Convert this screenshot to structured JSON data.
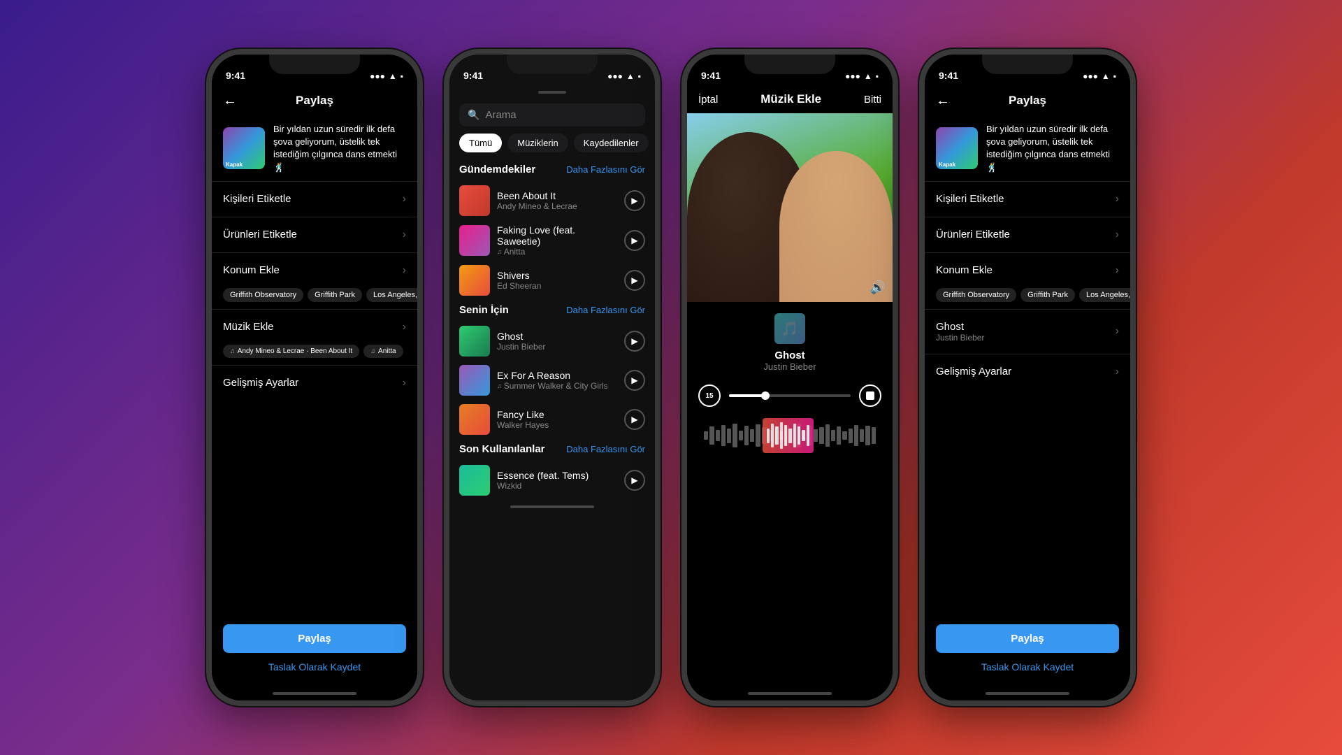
{
  "background": {
    "gradient": "linear-gradient(135deg, #3a1c8c 0%, #7b2d8b 40%, #c0392b 70%, #e74c3c 100%)"
  },
  "phones": {
    "phone1": {
      "status": {
        "time": "9:41",
        "signal": "●●●",
        "wifi": "wifi",
        "battery": "battery"
      },
      "header": {
        "title": "Paylaş",
        "back": "←"
      },
      "post": {
        "caption": "Bir yıldan uzun süredir ilk defa şova geliyorum, üstelik tek istediğim çılgınca dans etmekti 🕺",
        "cover_label": "Kapak"
      },
      "rows": [
        {
          "label": "Kişileri Etiketle",
          "has_arrow": true
        },
        {
          "label": "Ürünleri Etiketle",
          "has_arrow": true
        },
        {
          "label": "Konum Ekle",
          "has_arrow": true
        }
      ],
      "location_tags": [
        "Griffith Observatory",
        "Griffith Park",
        "Los Angeles,"
      ],
      "music_row": {
        "label": "Müzik Ekle",
        "has_arrow": true
      },
      "music_tags": [
        "Andy Mineo & Lecrae · Been About It",
        "Anitta"
      ],
      "advanced": {
        "label": "Gelişmiş Ayarlar",
        "has_arrow": true
      },
      "share_btn": "Paylaş",
      "draft_btn": "Taslak Olarak Kaydet"
    },
    "phone2": {
      "status": {
        "time": "9:41"
      },
      "search": {
        "placeholder": "Arama"
      },
      "filters": [
        "Tümü",
        "Müziklerin",
        "Kaydedilenler"
      ],
      "active_filter": 0,
      "sections": {
        "trending": {
          "title": "Gündemdekiler",
          "more": "Daha Fazlasını Gör",
          "items": [
            {
              "title": "Been About It",
              "artist": "Andy Mineo & Lecrae",
              "thumb_class": "thumb-been"
            },
            {
              "title": "Faking Love (feat. Saweetie)",
              "artist": "Anitta",
              "has_note": true,
              "thumb_class": "thumb-faking"
            },
            {
              "title": "Shivers",
              "artist": "Ed Sheeran",
              "thumb_class": "thumb-shivers"
            }
          ]
        },
        "for_you": {
          "title": "Senin İçin",
          "more": "Daha Fazlasını Gör",
          "items": [
            {
              "title": "Ghost",
              "artist": "Justin Bieber",
              "thumb_class": "thumb-ghost"
            },
            {
              "title": "Ex For A Reason",
              "artist": "Summer Walker & City Girls",
              "has_note": true,
              "thumb_class": "thumb-ex"
            },
            {
              "title": "Fancy Like",
              "artist": "Walker Hayes",
              "thumb_class": "thumb-fancy"
            }
          ]
        },
        "recent": {
          "title": "Son Kullanılanlar",
          "more": "Daha Fazlasını Gör",
          "items": [
            {
              "title": "Essence (feat. Tems)",
              "artist": "Wizkid",
              "thumb_class": "thumb-essence"
            }
          ]
        }
      }
    },
    "phone3": {
      "status": {
        "time": "9:41"
      },
      "header": {
        "cancel": "İptal",
        "title": "Müzik Ekle",
        "done": "Bitti"
      },
      "song": {
        "name": "Ghost",
        "artist": "Justin Bieber"
      },
      "playback": {
        "skip": "15",
        "progress": 30,
        "stop_label": "■"
      }
    },
    "phone4": {
      "status": {
        "time": "9:41"
      },
      "header": {
        "title": "Paylaş",
        "back": "←"
      },
      "post": {
        "caption": "Bir yıldan uzun süredir ilk defa şova geliyorum, üstelik tek istediğim çılgınca dans etmekti 🕺",
        "cover_label": "Kapak"
      },
      "rows": [
        {
          "label": "Kişileri Etiketle",
          "has_arrow": true
        },
        {
          "label": "Ürünleri Etiketle",
          "has_arrow": true
        },
        {
          "label": "Konum Ekle",
          "has_arrow": true
        }
      ],
      "location_tags": [
        "Griffith Observatory",
        "Griffith Park",
        "Los Angeles,"
      ],
      "music": {
        "label": "Ghost",
        "sublabel": "Justin Bieber",
        "has_arrow": true
      },
      "advanced": {
        "label": "Gelişmiş Ayarlar",
        "has_arrow": true
      },
      "share_btn": "Paylaş",
      "draft_btn": "Taslak Olarak Kaydet"
    }
  }
}
